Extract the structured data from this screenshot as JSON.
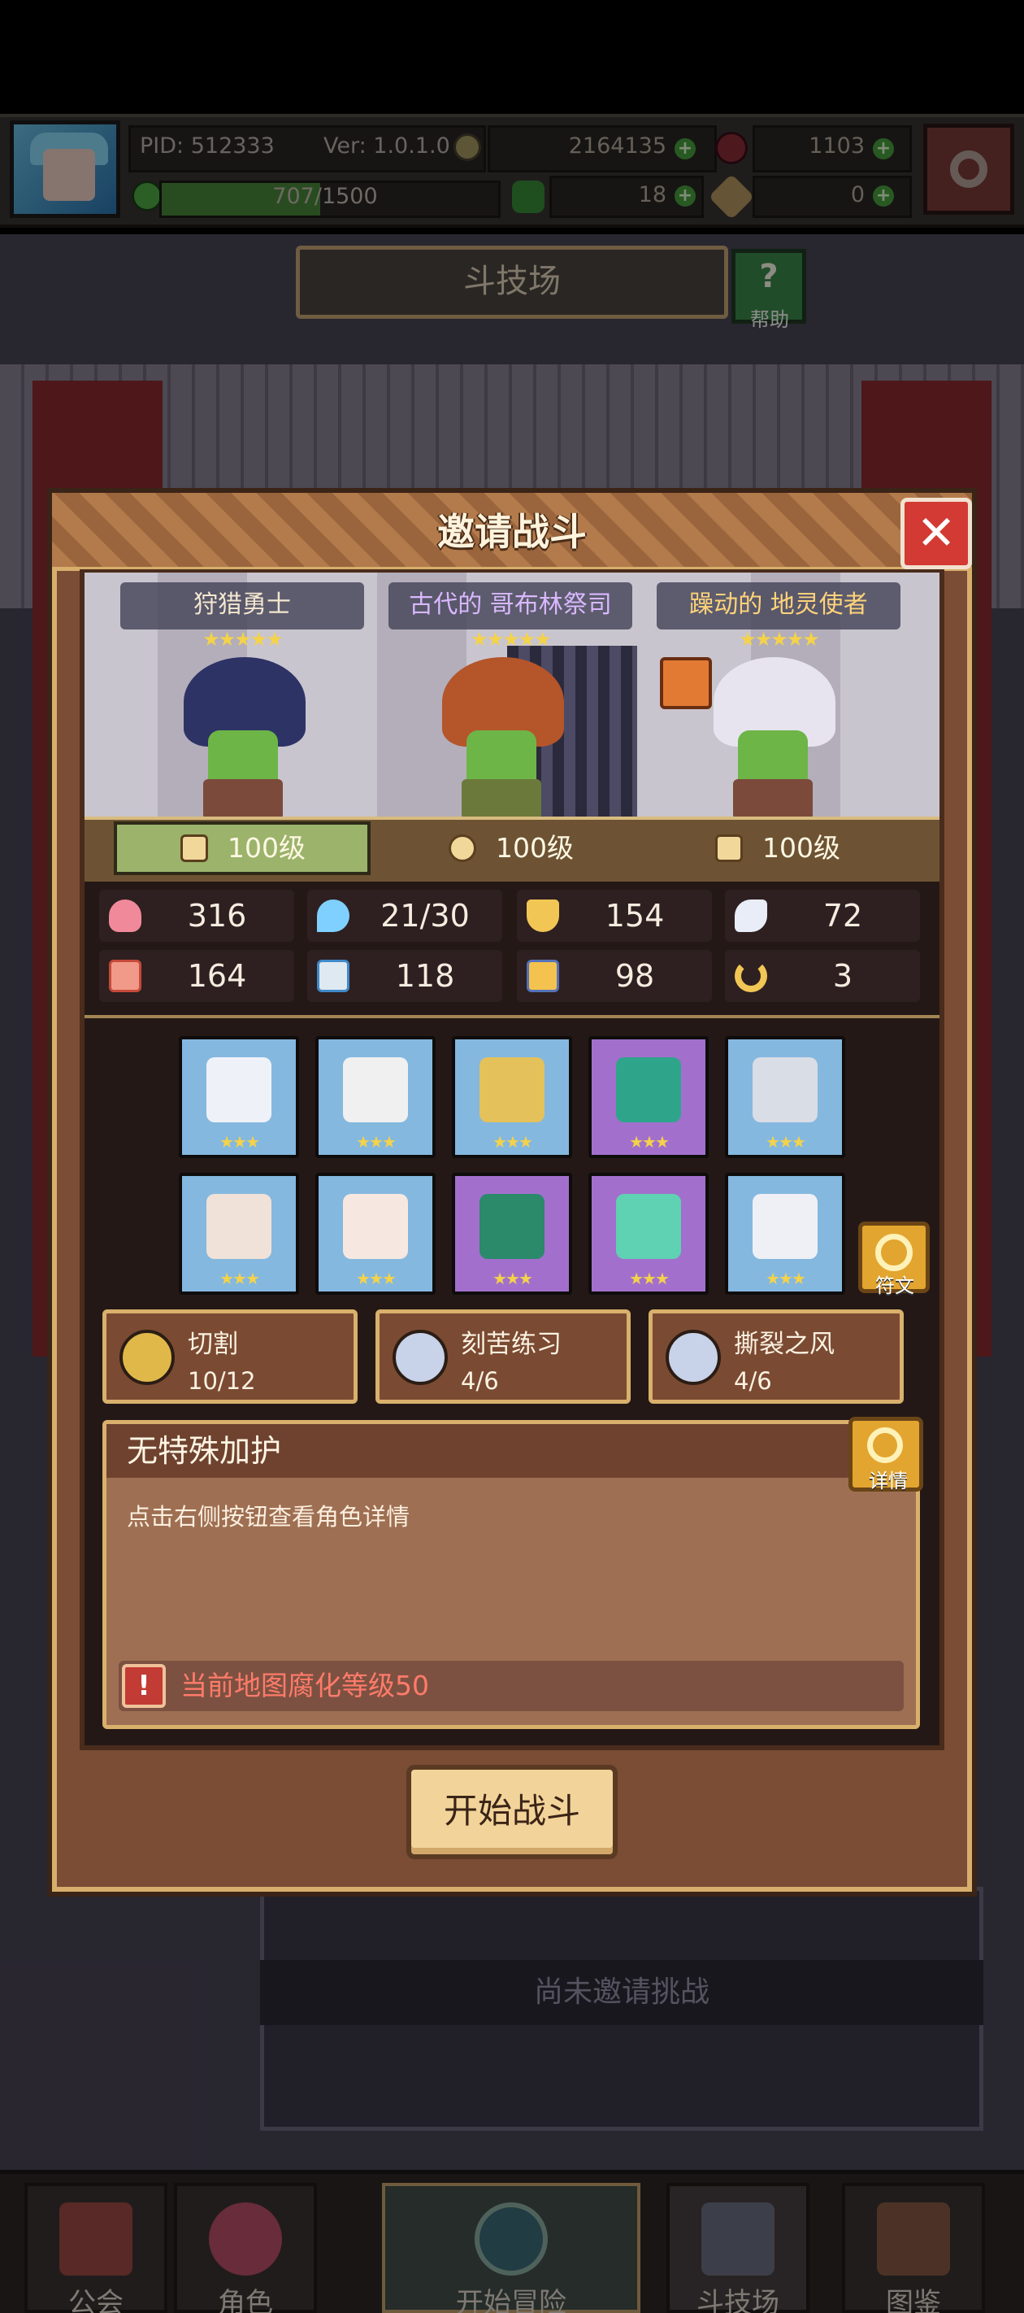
{
  "status": {
    "pid": "PID: 512333",
    "version": "Ver: 1.0.1.0",
    "gold": "2164135",
    "gems": "1103",
    "xp": "707/1500",
    "xp_fraction": 0.471,
    "clover": "18",
    "keys": "0"
  },
  "arena": {
    "title": "斗技场",
    "help_label": "帮助",
    "no_challenge": "尚未邀请挑战"
  },
  "dialog": {
    "title": "邀请战斗",
    "close_icon": "close-icon",
    "characters": [
      {
        "name": "狩猎勇士",
        "stars": "★★★★★",
        "level": "100级"
      },
      {
        "name": "古代的 哥布林祭司",
        "stars": "★★★★★",
        "level": "100级"
      },
      {
        "name": "躁动的 地灵使者",
        "stars": "★★★★★",
        "level": "100级"
      }
    ],
    "stats": [
      {
        "icon": "heart-icon",
        "value": "316"
      },
      {
        "icon": "water-drop-icon",
        "value": "21/30"
      },
      {
        "icon": "shield-icon",
        "value": "154"
      },
      {
        "icon": "wing-icon",
        "value": "72"
      },
      {
        "icon": "fist-icon",
        "value": "164"
      },
      {
        "icon": "book-icon",
        "value": "118"
      },
      {
        "icon": "boot-icon",
        "value": "98"
      },
      {
        "icon": "horseshoe-icon",
        "value": "3"
      }
    ],
    "equipment": [
      {
        "icon": "sword-icon",
        "rarity": "blue",
        "stars": "★★★"
      },
      {
        "icon": "dagger-icon",
        "rarity": "blue",
        "stars": "★★★"
      },
      {
        "icon": "necklace-icon",
        "rarity": "blue",
        "stars": "★★★"
      },
      {
        "icon": "emerald-amulet-icon",
        "rarity": "purple",
        "stars": "★★★"
      },
      {
        "icon": "helmet-icon",
        "rarity": "blue",
        "stars": "★★★"
      },
      {
        "icon": "collar-icon",
        "rarity": "blue",
        "stars": "★★★"
      },
      {
        "icon": "armor-icon",
        "rarity": "blue",
        "stars": "★★★"
      },
      {
        "icon": "bracer-icon",
        "rarity": "purple",
        "stars": "★★★"
      },
      {
        "icon": "gem-ring-icon",
        "rarity": "purple",
        "stars": "★★★"
      },
      {
        "icon": "boots-icon",
        "rarity": "blue",
        "stars": "★★★"
      }
    ],
    "rune_label": "符文",
    "skills": [
      {
        "name": "切割",
        "level": "10/12"
      },
      {
        "name": "刻苦练习",
        "level": "4/6"
      },
      {
        "name": "撕裂之风",
        "level": "4/6"
      }
    ],
    "blessing": {
      "title": "无特殊加护",
      "desc": "点击右侧按钮查看角色详情",
      "detail_label": "详情",
      "warning_icon": "!",
      "warning": "当前地图腐化等级50"
    },
    "start_button": "开始战斗"
  },
  "nav": [
    {
      "label": "公会"
    },
    {
      "label": "角色"
    },
    {
      "label": "开始冒险"
    },
    {
      "label": "斗技场"
    },
    {
      "label": "图鉴"
    }
  ],
  "colors": {
    "accent_gold": "#d7ae6c",
    "warning_red": "#ff7b6a",
    "panel_brown": "#7b4d35",
    "rare_blue": "#84b8df",
    "epic_purple": "#a270cc"
  }
}
